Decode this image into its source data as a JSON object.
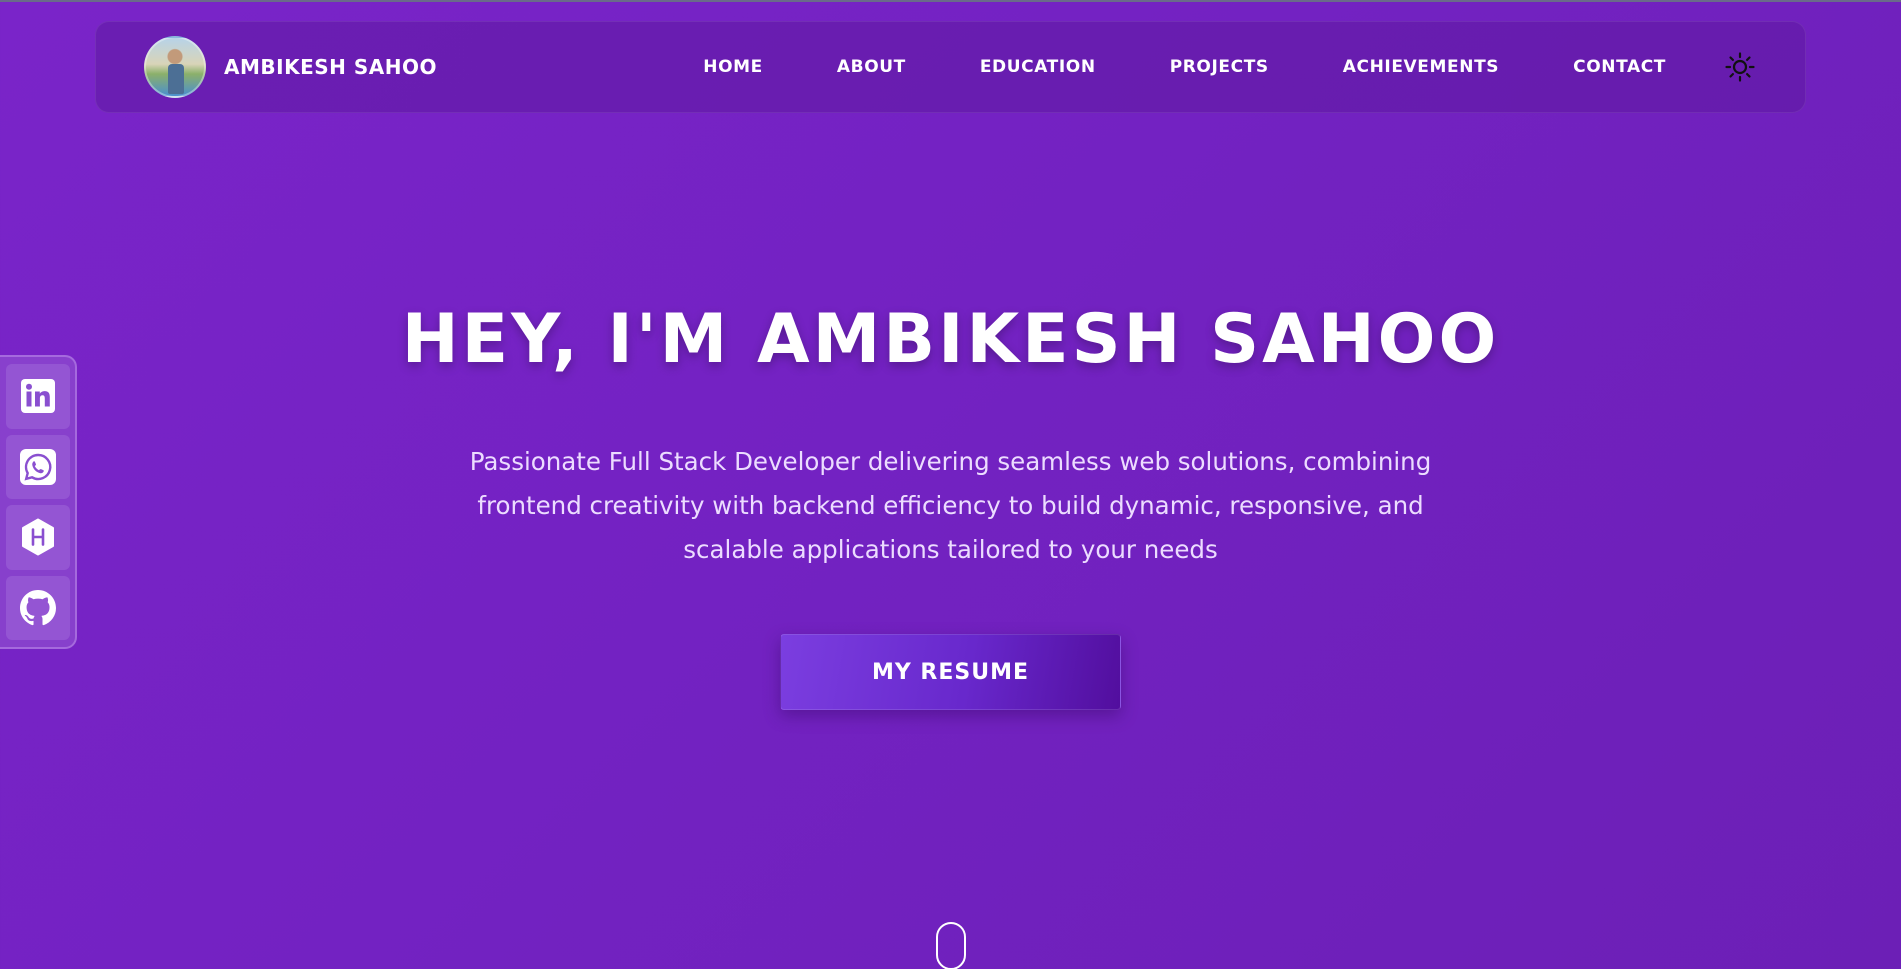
{
  "navbar": {
    "brand_name": "AMBIKESH SAHOO",
    "links": [
      "HOME",
      "ABOUT",
      "EDUCATION",
      "PROJECTS",
      "ACHIEVEMENTS",
      "CONTACT"
    ],
    "theme_icon": "sun-icon"
  },
  "social": {
    "items": [
      {
        "icon": "linkedin-icon"
      },
      {
        "icon": "whatsapp-icon"
      },
      {
        "icon": "hashnode-icon"
      },
      {
        "icon": "github-icon"
      }
    ]
  },
  "hero": {
    "title": "HEY, I'M AMBIKESH SAHOO",
    "subtitle": "Passionate Full Stack Developer delivering seamless web solutions, combining frontend creativity with backend efficiency to build dynamic, responsive, and scalable applications tailored to your needs",
    "resume_label": "MY RESUME"
  },
  "colors": {
    "background": "#7322c2",
    "navbar": "#5f19a0",
    "button": "#6828cc",
    "text": "#ffffff",
    "subtitle_text": "#ecdcff"
  }
}
